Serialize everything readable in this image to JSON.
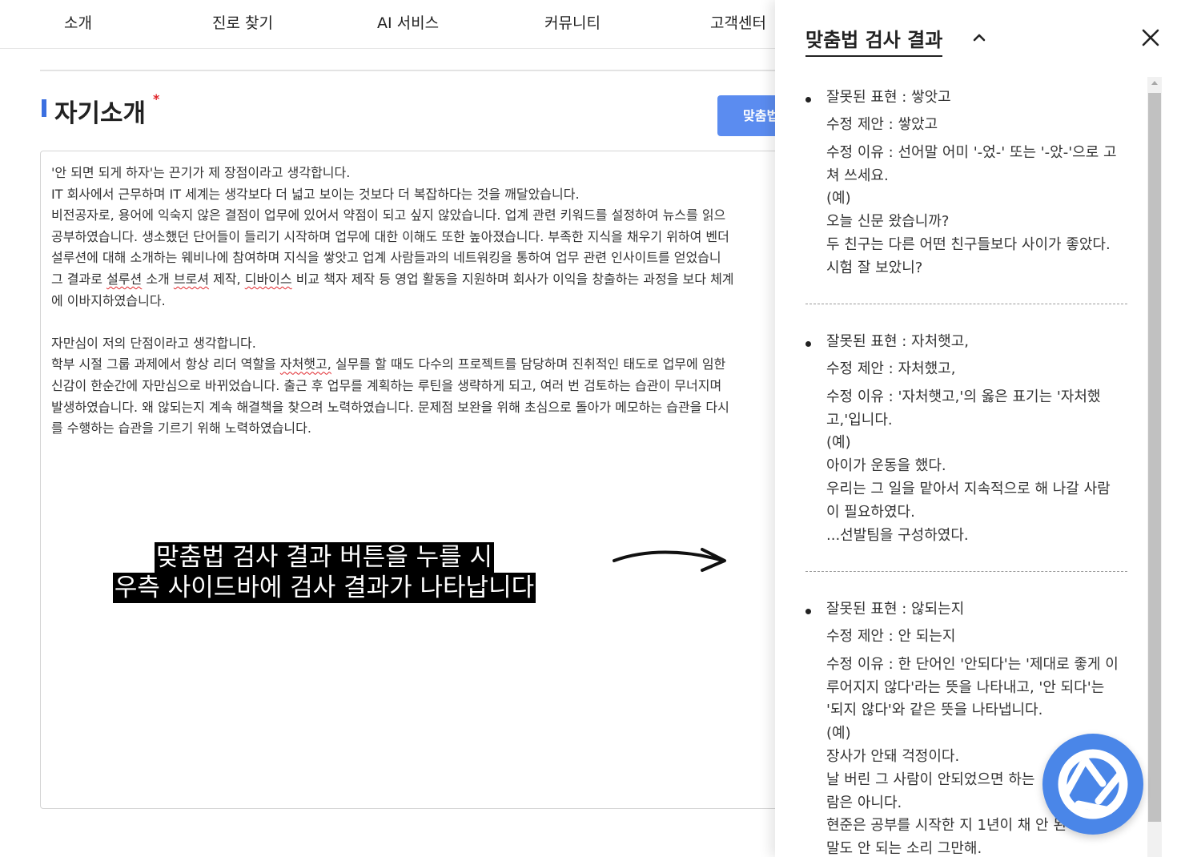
{
  "nav": [
    "소개",
    "진로 찾기",
    "AI 서비스",
    "커뮤니티",
    "고객센터"
  ],
  "section": {
    "title": "자기소개",
    "required_mark": "*",
    "button_label": "맞춤법"
  },
  "essay": {
    "lines": [
      [
        "'안 되면 되게 하자'는 끈기가 제 장점이라고 생각합니다."
      ],
      [
        "IT 회사에서 근무하며 IT 세계는 생각보다 더 넓고 보이는 것보다 더 복잡하다는 것을 깨달았습니다."
      ],
      [
        "비전공자로, 용어에 익숙지 않은 결점이 업무에 있어서 약점이 되고 싶지 않았습니다. 업계 관련 키워드를 설정하여 뉴스를 읽으"
      ],
      [
        "공부하였습니다. 생소했던 단어들이 들리기 시작하며 업무에 대한 이해도 또한 높아졌습니다. 부족한 지식을 채우기 위하여 벤더"
      ],
      [
        "설루션에 대해 소개하는 웨비나에 참여하며 지식을 쌓앗고 업계 사람들과의 네트워킹을 통하여 업무 관련 인사이트를 얻었습니"
      ],
      [
        "그 결과로 ",
        "설루션",
        " 소개 ",
        "브로셔",
        " 제작, ",
        "디바이스",
        " 비교 책자 제작 등 영업 활동을 지원하며 회사가 이익을 창출하는 과정을 보다 체계"
      ],
      [
        "에 이바지하였습니다."
      ],
      [
        ""
      ],
      [
        "자만심이 저의 단점이라고 생각합니다."
      ],
      [
        "학부 시절 그룹 과제에서 항상 리더 역할을 ",
        "자처햇고,",
        " 실무를 할 때도 다수의 프로젝트를 담당하며 진취적인 태도로 업무에 임한"
      ],
      [
        "신감이 한순간에 자만심으로 바뀌었습니다. 출근 후 업무를 계획하는 루틴을 생략하게 되고, 여러 번 검토하는 습관이 무너지며"
      ],
      [
        "발생하였습니다. 왜 않되는지 계속 해결책을 찾으려 노력하였습니다. 문제점 보완을 위해 초심으로 돌아가 메모하는 습관을 다시"
      ],
      [
        "를 수행하는 습관을 기르기 위해 노력하였습니다."
      ]
    ]
  },
  "caption": [
    "맞춤법 검사 결과 버튼을 누를 시",
    "우측 사이드바에 검사 결과가 나타납니다"
  ],
  "sidebar": {
    "title": "맞춤법 검사 결과",
    "results": [
      {
        "wrong": "잘못된 표현 : 쌓앗고",
        "suggest": "수정 제안 : 쌓았고",
        "reason": [
          "수정 이유 : 선어말 어미 '-었-' 또는 '-았-'으로 고",
          "쳐 쓰세요."
        ],
        "examples": [
          "(예)",
          "오늘 신문 왔습니까?",
          "두 친구는 다른 어떤 친구들보다 사이가 좋았다.",
          "시험 잘 보았니?"
        ]
      },
      {
        "wrong": "잘못된 표현 : 자처햇고,",
        "suggest": "수정 제안 : 자처했고,",
        "reason": [
          "수정 이유 : '자처햇고,'의 옳은 표기는 '자처했",
          "고,'입니다."
        ],
        "examples": [
          "(예)",
          "아이가 운동을 했다.",
          "우리는 그 일을 맡아서 지속적으로 해 나갈 사람",
          "이 필요하였다.",
          "...선발팀을 구성하였다."
        ]
      },
      {
        "wrong": "잘못된 표현 : 않되는지",
        "suggest": "수정 제안 : 안 되는지",
        "reason": [
          "수정 이유 : 한 단어인  '안되다'는 '제대로 좋게 이",
          "루어지지 않다'라는 뜻을 나타내고, '안 되다'는",
          "'되지 않다'와 같은 뜻을 나타냅니다."
        ],
        "examples": [
          "(예)",
          "장사가 안돼 걱정이다.",
          "날 버린 그 사람이 안되었으면 하는",
          "람은 아니다.",
          "현준은 공부를 시작한 지 1년이 채 안 된",
          "말도 안 되는 소리 그만해."
        ]
      }
    ]
  }
}
